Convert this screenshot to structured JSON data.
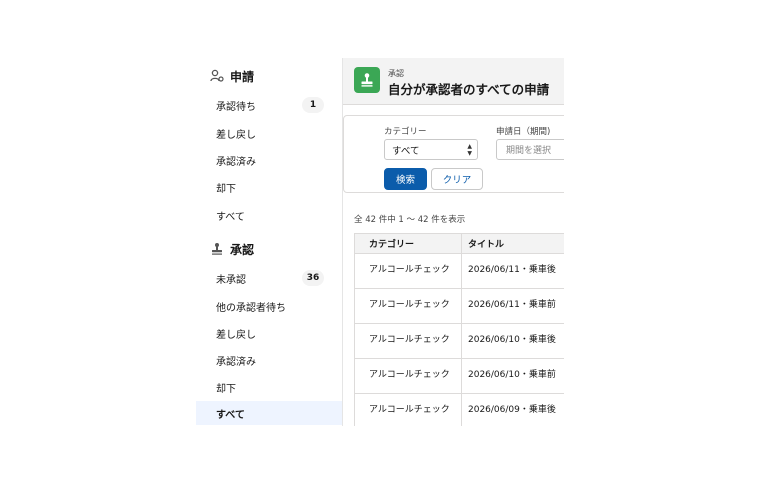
{
  "sidebar": {
    "request_section": {
      "title": "申請"
    },
    "request_items": [
      {
        "label": "承認待ち",
        "badge": "1"
      },
      {
        "label": "差し戻し"
      },
      {
        "label": "承認済み"
      },
      {
        "label": "却下"
      },
      {
        "label": "すべて"
      }
    ],
    "approval_section": {
      "title": "承認"
    },
    "approval_items": [
      {
        "label": "未承認",
        "badge": "36"
      },
      {
        "label": "他の承認者待ち"
      },
      {
        "label": "差し戻し"
      },
      {
        "label": "承認済み"
      },
      {
        "label": "却下"
      },
      {
        "label": "すべて"
      }
    ]
  },
  "header": {
    "eyebrow": "承認",
    "title": "自分が承認者のすべての申請",
    "icon_color": "#3ba755"
  },
  "filters": {
    "category_label": "カテゴリー",
    "category_value": "すべて",
    "date_label": "申請日（期間)",
    "date_placeholder": "期間を選択",
    "search_button": "検索",
    "clear_button": "クリア"
  },
  "results": {
    "count_text": "全 42 件中 1 〜 42 件を表示"
  },
  "table": {
    "columns": [
      "カテゴリー",
      "タイトル"
    ],
    "rows": [
      {
        "category": "アルコールチェック",
        "title": "2026/06/11・乗車後"
      },
      {
        "category": "アルコールチェック",
        "title": "2026/06/11・乗車前"
      },
      {
        "category": "アルコールチェック",
        "title": "2026/06/10・乗車後"
      },
      {
        "category": "アルコールチェック",
        "title": "2026/06/10・乗車前"
      },
      {
        "category": "アルコールチェック",
        "title": "2026/06/09・乗車後"
      }
    ]
  },
  "colors": {
    "primary": "#0b5cab",
    "active_bg": "#eef4ff",
    "header_bg": "#f3f3f3"
  }
}
